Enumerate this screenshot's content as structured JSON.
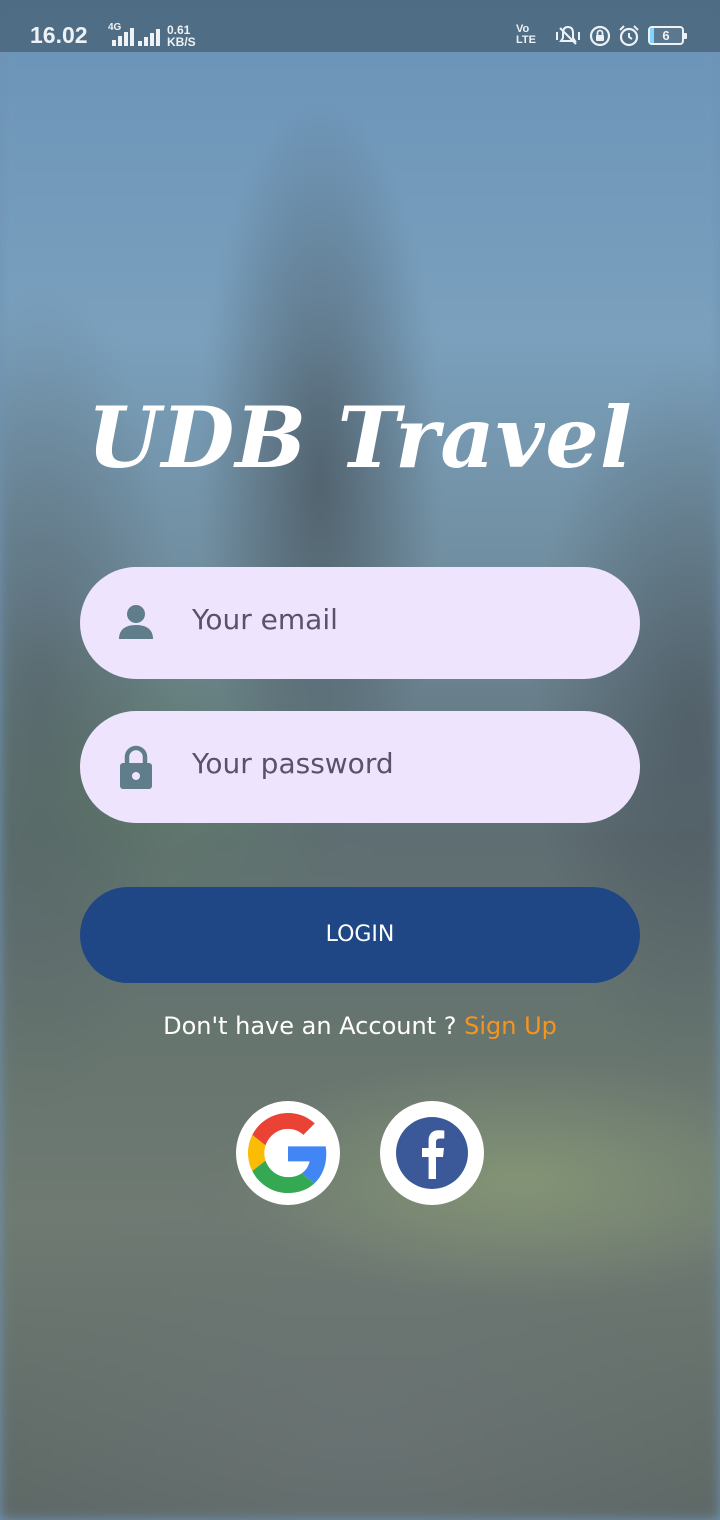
{
  "status_bar": {
    "time": "16.02",
    "network_type": "4G",
    "data_speed_value": "0.61",
    "data_speed_unit": "KB/S",
    "volte_top": "Vo",
    "volte_bottom": "LTE",
    "battery_level": "6"
  },
  "app": {
    "title": "UDB Travel"
  },
  "login_form": {
    "email_placeholder": "Your email",
    "password_placeholder": "Your password",
    "login_button_label": "LOGIN",
    "no_account_text": "Don't have an Account ? ",
    "sign_up_label": "Sign Up"
  },
  "social": {
    "google_icon": "google-icon",
    "facebook_icon": "facebook-icon"
  },
  "colors": {
    "field_background": "#efe4fe",
    "login_button": "#1f4785",
    "sign_up_link": "#f7941d",
    "icon_gray": "#607d8b",
    "facebook_blue": "#3b5998"
  }
}
